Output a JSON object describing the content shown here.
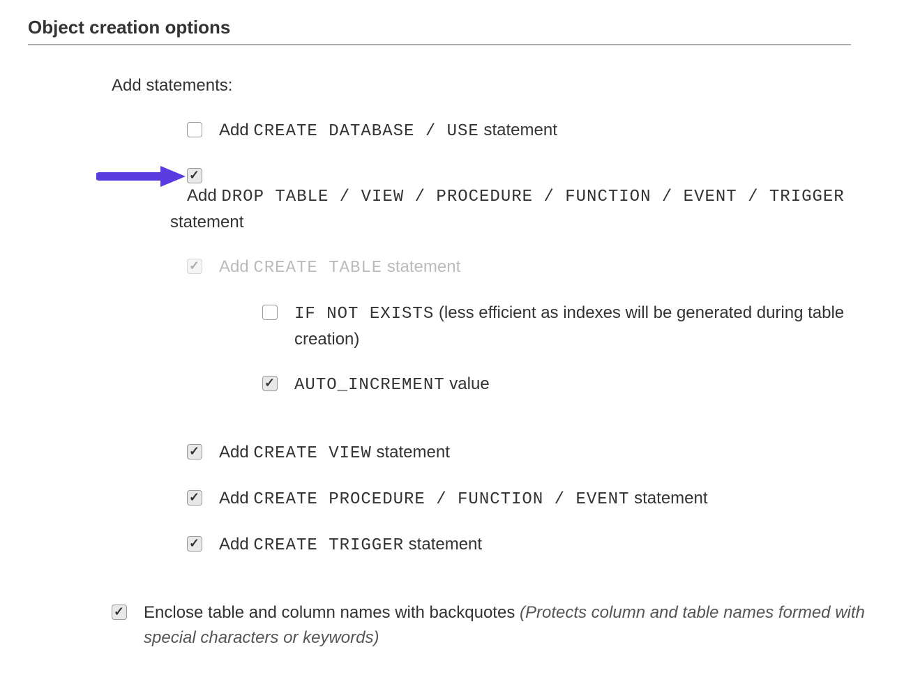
{
  "section_header": "Object creation options",
  "add_statements_heading": "Add statements:",
  "options": {
    "create_db": {
      "prefix": "Add ",
      "code": "CREATE DATABASE / USE",
      "suffix": " statement",
      "checked": false
    },
    "drop_table": {
      "prefix": "Add ",
      "code": "DROP TABLE / VIEW / PROCEDURE / FUNCTION / EVENT / TRIGGER",
      "suffix": "statement",
      "checked": true
    },
    "create_table": {
      "prefix": "Add ",
      "code": "CREATE TABLE",
      "suffix": " statement",
      "checked": true,
      "disabled": true
    },
    "if_not_exists": {
      "code": "IF NOT EXISTS",
      "suffix": " (less efficient as indexes will be generated during table creation)",
      "checked": false
    },
    "auto_increment": {
      "code": "AUTO_INCREMENT",
      "suffix": " value",
      "checked": true
    },
    "create_view": {
      "prefix": "Add ",
      "code": "CREATE VIEW",
      "suffix": " statement",
      "checked": true
    },
    "create_proc": {
      "prefix": "Add ",
      "code": "CREATE PROCEDURE / FUNCTION / EVENT",
      "suffix": " statement",
      "checked": true
    },
    "create_trigger": {
      "prefix": "Add ",
      "code": "CREATE TRIGGER",
      "suffix": " statement",
      "checked": true
    },
    "backquotes": {
      "prefix": "Enclose table and column names with backquotes ",
      "note": "(Protects column and table names formed with special characters or keywords)",
      "checked": true
    }
  },
  "arrow_color": "#5a3be0"
}
